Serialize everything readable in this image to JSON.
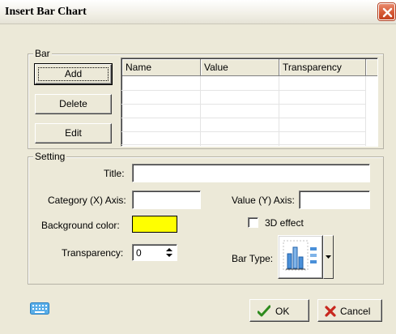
{
  "dialog": {
    "title": "Insert Bar Chart"
  },
  "bar_group": {
    "label": "Bar",
    "buttons": {
      "add": "Add",
      "delete": "Delete",
      "edit": "Edit"
    },
    "columns": [
      "Name",
      "Value",
      "Transparency"
    ],
    "rows": []
  },
  "setting_group": {
    "label": "Setting",
    "title_label": "Title:",
    "title_value": "",
    "category_label": "Category (X) Axis:",
    "category_value": "",
    "value_label": "Value (Y) Axis:",
    "value_value": "",
    "background_label": "Background color:",
    "background_color": "#ffff00",
    "effect_label": "3D effect",
    "effect_checked": false,
    "transparency_label": "Transparency:",
    "transparency_value": "0",
    "bar_type_label": "Bar Type:",
    "bar_type_icon": "vertical-bar-chart-icon"
  },
  "footer": {
    "ok": "OK",
    "cancel": "Cancel",
    "keyboard_icon": "keyboard-icon"
  },
  "colors": {
    "ok_check": "#2e8b1e",
    "cancel_x": "#c8281e",
    "close_button": "#d65a36"
  }
}
